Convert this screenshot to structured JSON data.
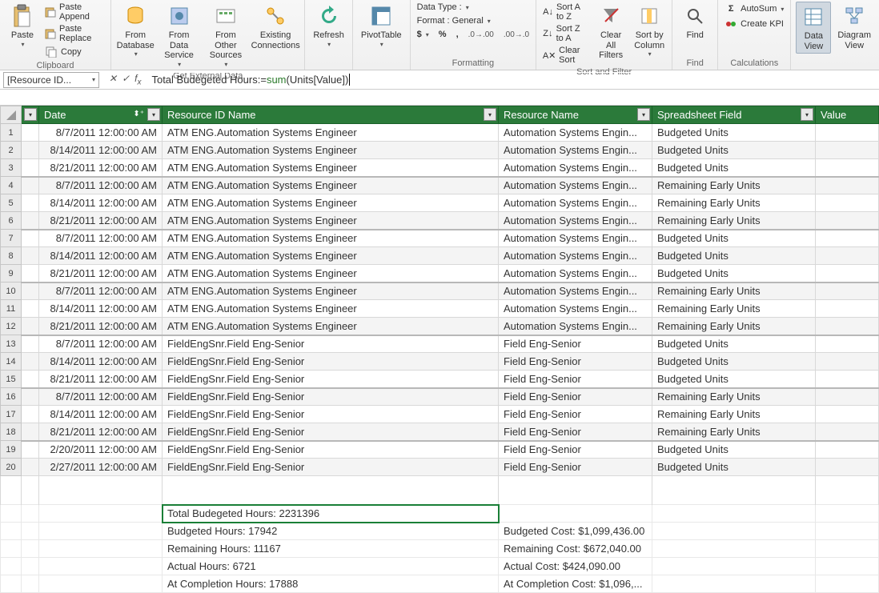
{
  "ribbon": {
    "clipboard": {
      "paste": "Paste",
      "paste_append": "Paste Append",
      "paste_replace": "Paste Replace",
      "copy": "Copy",
      "label": "Clipboard"
    },
    "external": {
      "from_db": "From\nDatabase",
      "from_ds": "From Data\nService",
      "from_other": "From Other\nSources",
      "existing": "Existing\nConnections",
      "label": "Get External Data"
    },
    "refresh": "Refresh",
    "pivot": "PivotTable",
    "formatting": {
      "datatype": "Data Type :",
      "format": "Format : General",
      "label": "Formatting"
    },
    "sort": {
      "az": "Sort A to Z",
      "za": "Sort Z to A",
      "clear": "Clear Sort",
      "clear_filters": "Clear All\nFilters",
      "sort_by": "Sort by\nColumn",
      "label": "Sort and Filter"
    },
    "find": {
      "find": "Find",
      "label": "Find"
    },
    "calc": {
      "autosum": "AutoSum",
      "kpi": "Create KPI",
      "label": "Calculations"
    },
    "view": {
      "data": "Data\nView",
      "diagram": "Diagram\nView"
    }
  },
  "formula_bar": {
    "name_box": "[Resource ID...",
    "formula_prefix": "Total Budegeted Hours:=",
    "formula_fn": "sum",
    "formula_suffix": "(Units[Value])"
  },
  "columns": {
    "date": "Date",
    "resid": "Resource ID Name",
    "resname": "Resource Name",
    "field": "Spreadsheet Field",
    "value": "Value"
  },
  "rows": [
    {
      "n": 1,
      "date": "8/7/2011 12:00:00 AM",
      "resid": "ATM ENG.Automation Systems Engineer",
      "resname": "Automation Systems Engin...",
      "field": "Budgeted Units"
    },
    {
      "n": 2,
      "date": "8/14/2011 12:00:00 AM",
      "resid": "ATM ENG.Automation Systems Engineer",
      "resname": "Automation Systems Engin...",
      "field": "Budgeted Units"
    },
    {
      "n": 3,
      "date": "8/21/2011 12:00:00 AM",
      "resid": "ATM ENG.Automation Systems Engineer",
      "resname": "Automation Systems Engin...",
      "field": "Budgeted Units"
    },
    {
      "n": 4,
      "date": "8/7/2011 12:00:00 AM",
      "resid": "ATM ENG.Automation Systems Engineer",
      "resname": "Automation Systems Engin...",
      "field": "Remaining Early Units",
      "seg": true
    },
    {
      "n": 5,
      "date": "8/14/2011 12:00:00 AM",
      "resid": "ATM ENG.Automation Systems Engineer",
      "resname": "Automation Systems Engin...",
      "field": "Remaining Early Units"
    },
    {
      "n": 6,
      "date": "8/21/2011 12:00:00 AM",
      "resid": "ATM ENG.Automation Systems Engineer",
      "resname": "Automation Systems Engin...",
      "field": "Remaining Early Units"
    },
    {
      "n": 7,
      "date": "8/7/2011 12:00:00 AM",
      "resid": "ATM ENG.Automation Systems Engineer",
      "resname": "Automation Systems Engin...",
      "field": "Budgeted Units",
      "seg": true
    },
    {
      "n": 8,
      "date": "8/14/2011 12:00:00 AM",
      "resid": "ATM ENG.Automation Systems Engineer",
      "resname": "Automation Systems Engin...",
      "field": "Budgeted Units"
    },
    {
      "n": 9,
      "date": "8/21/2011 12:00:00 AM",
      "resid": "ATM ENG.Automation Systems Engineer",
      "resname": "Automation Systems Engin...",
      "field": "Budgeted Units"
    },
    {
      "n": 10,
      "date": "8/7/2011 12:00:00 AM",
      "resid": "ATM ENG.Automation Systems Engineer",
      "resname": "Automation Systems Engin...",
      "field": "Remaining Early Units",
      "seg": true
    },
    {
      "n": 11,
      "date": "8/14/2011 12:00:00 AM",
      "resid": "ATM ENG.Automation Systems Engineer",
      "resname": "Automation Systems Engin...",
      "field": "Remaining Early Units"
    },
    {
      "n": 12,
      "date": "8/21/2011 12:00:00 AM",
      "resid": "ATM ENG.Automation Systems Engineer",
      "resname": "Automation Systems Engin...",
      "field": "Remaining Early Units"
    },
    {
      "n": 13,
      "date": "8/7/2011 12:00:00 AM",
      "resid": "FieldEngSnr.Field Eng-Senior",
      "resname": "Field Eng-Senior",
      "field": "Budgeted Units",
      "seg": true
    },
    {
      "n": 14,
      "date": "8/14/2011 12:00:00 AM",
      "resid": "FieldEngSnr.Field Eng-Senior",
      "resname": "Field Eng-Senior",
      "field": "Budgeted Units"
    },
    {
      "n": 15,
      "date": "8/21/2011 12:00:00 AM",
      "resid": "FieldEngSnr.Field Eng-Senior",
      "resname": "Field Eng-Senior",
      "field": "Budgeted Units"
    },
    {
      "n": 16,
      "date": "8/7/2011 12:00:00 AM",
      "resid": "FieldEngSnr.Field Eng-Senior",
      "resname": "Field Eng-Senior",
      "field": "Remaining Early Units",
      "seg": true
    },
    {
      "n": 17,
      "date": "8/14/2011 12:00:00 AM",
      "resid": "FieldEngSnr.Field Eng-Senior",
      "resname": "Field Eng-Senior",
      "field": "Remaining Early Units"
    },
    {
      "n": 18,
      "date": "8/21/2011 12:00:00 AM",
      "resid": "FieldEngSnr.Field Eng-Senior",
      "resname": "Field Eng-Senior",
      "field": "Remaining Early Units"
    },
    {
      "n": 19,
      "date": "2/20/2011 12:00:00 AM",
      "resid": "FieldEngSnr.Field Eng-Senior",
      "resname": "Field Eng-Senior",
      "field": "Budgeted Units",
      "seg": true
    },
    {
      "n": 20,
      "date": "2/27/2011 12:00:00 AM",
      "resid": "FieldEngSnr.Field Eng-Senior",
      "resname": "Field Eng-Senior",
      "field": "Budgeted Units"
    }
  ],
  "calc": {
    "total": "Total Budegeted Hours: 2231396",
    "budget_h": "Budgeted Hours: 17942",
    "remain_h": "Remaining Hours: 11167",
    "actual_h": "Actual Hours: 6721",
    "atcomp_h": "At Completion Hours: 17888",
    "budget_c": "Budgeted Cost: $1,099,436.00",
    "remain_c": "Remaining Cost: $672,040.00",
    "actual_c": "Actual Cost: $424,090.00",
    "atcomp_c": "At Completion Cost: $1,096,..."
  }
}
